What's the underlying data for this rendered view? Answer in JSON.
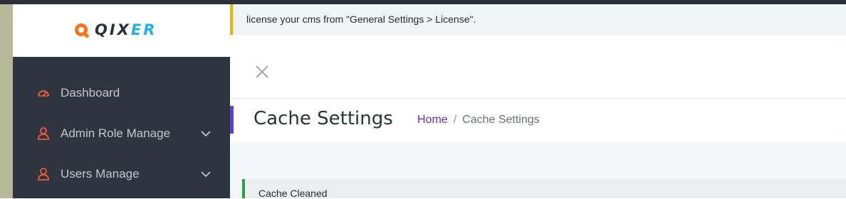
{
  "brand": {
    "logo_text_1": "QIX",
    "logo_text_2": "ER"
  },
  "colors": {
    "accent_orange": "#f7751f",
    "brand_blue": "#1fb1e9",
    "sidebar_bg": "#2f353f",
    "link_purple": "#5a2fd8",
    "success_green": "#2f9f45",
    "warning_yellow": "#e6b400"
  },
  "sidebar": {
    "items": [
      {
        "label": "Dashboard",
        "icon": "speedometer-icon",
        "has_submenu": false
      },
      {
        "label": "Admin Role Manage",
        "icon": "user-icon",
        "has_submenu": true
      },
      {
        "label": "Users Manage",
        "icon": "user-icon",
        "has_submenu": true
      }
    ]
  },
  "notice": {
    "text": "license your cms from \"General Settings > License\"."
  },
  "header": {
    "title": "Cache Settings",
    "breadcrumb": {
      "home": "Home",
      "separator": "/",
      "current": "Cache Settings"
    }
  },
  "alert": {
    "text": "Cache Cleaned"
  }
}
